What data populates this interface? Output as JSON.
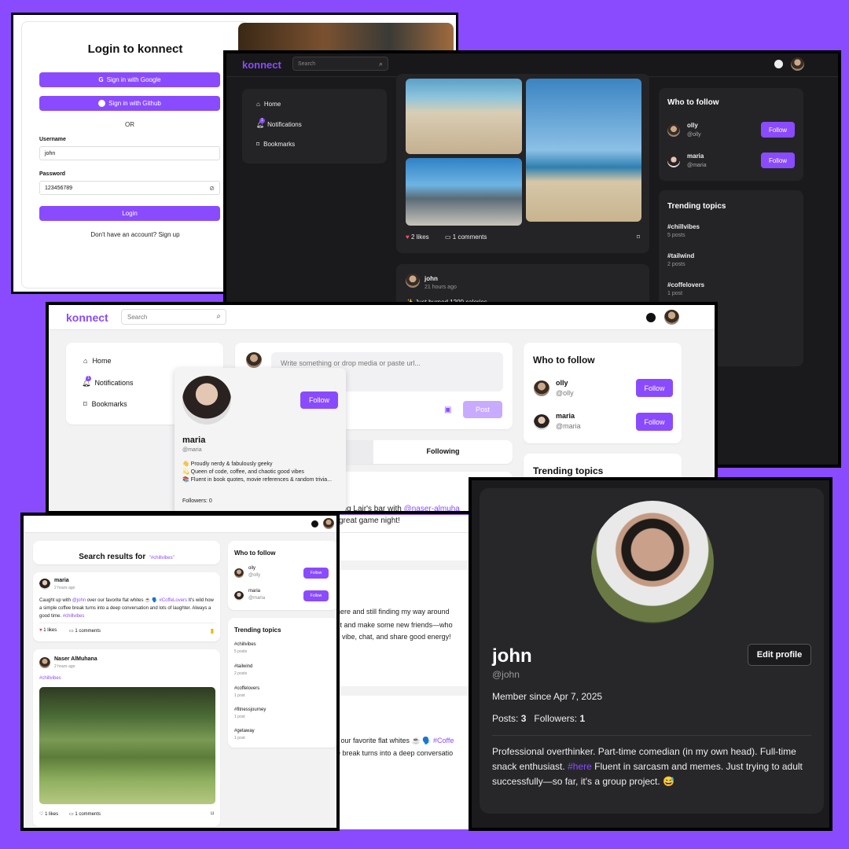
{
  "brand": "konnect",
  "colors": {
    "accent": "#8a4bff",
    "dark_bg": "#1a1a1c",
    "light_bg": "#f2f2f3"
  },
  "login": {
    "title": "Login to konnect",
    "google_btn": "Sign in with Google",
    "github_btn": "Sign in with Github",
    "or": "OR",
    "username_label": "Username",
    "username_value": "john",
    "password_label": "Password",
    "password_value": "123456789",
    "login_btn": "Login",
    "signup_text": "Don't have an account? Sign up"
  },
  "dark": {
    "search_placeholder": "Search",
    "nav": [
      {
        "label": "Home",
        "icon": "home-icon"
      },
      {
        "label": "Notifications",
        "icon": "bell-icon",
        "badge": "1"
      },
      {
        "label": "Bookmarks",
        "icon": "bookmark-icon"
      }
    ],
    "post": {
      "likes": "2 likes",
      "comments": "1 comments"
    },
    "post2": {
      "author": "john",
      "time": "21 hours ago",
      "text": "✨ Just burned 1200 calories"
    },
    "who_to_follow": {
      "title": "Who to follow",
      "users": [
        {
          "name": "olly",
          "handle": "@olly",
          "btn": "Follow"
        },
        {
          "name": "maria",
          "handle": "@maria",
          "btn": "Follow"
        }
      ]
    },
    "trending": {
      "title": "Trending topics",
      "items": [
        {
          "tag": "#chillvibes",
          "count": "5 posts"
        },
        {
          "tag": "#tailwind",
          "count": "2 posts"
        },
        {
          "tag": "#coffelovers",
          "count": "1 post"
        }
      ]
    }
  },
  "light": {
    "search_placeholder": "Search",
    "nav": [
      {
        "label": "Home"
      },
      {
        "label": "Notifications",
        "badge": "1"
      },
      {
        "label": "Bookmarks"
      }
    ],
    "composer_placeholder": "Write something or drop media or paste url...",
    "post_btn": "Post",
    "tab_following": "Following",
    "hover_card": {
      "name": "maria",
      "handle": "@maria",
      "follow": "Follow",
      "bio": [
        "👋 Proudly nerdy & fabulously geeky",
        "💫 Queen of code, coffee, and chaotic good vibes",
        "📚 Fluent in book quotes, movie references & random trivia..."
      ],
      "followers": "Followers: 0"
    },
    "feed_line1": "...had an amazing time playing Lair's bar with",
    "feed_mention": "@naser-almuha",
    "feed_line2": "great game night!",
    "who_to_follow": {
      "title": "Who to follow",
      "users": [
        {
          "name": "olly",
          "handle": "@olly",
          "btn": "Follow"
        },
        {
          "name": "maria",
          "handle": "@maria",
          "btn": "Follow"
        }
      ]
    },
    "trending_title": "Trending topics"
  },
  "search": {
    "title_prefix": "Search results for",
    "query": "\"#chillvibes\"",
    "post1": {
      "author": "maria",
      "time": "2 hours ago",
      "text1": "Caught up with",
      "mention": "@john",
      "text2": "over our favorite flat whites ☕ 🗣️",
      "tag1": "#CoffeLovers",
      "text3": "It's wild how a simple coffee break turns into a deep conversation and lots of laughter. Always a good time.",
      "tag2": "#chillvibes",
      "likes": "1 likes",
      "comments": "1 comments"
    },
    "post2": {
      "author": "Naser AlMuhana",
      "time": "2 hours ago",
      "tag": "#chillvibes",
      "likes": "1 likes",
      "comments": "1 comments"
    },
    "who_to_follow": {
      "title": "Who to follow",
      "users": [
        {
          "name": "olly",
          "handle": "@olly",
          "btn": "Follow"
        },
        {
          "name": "maria",
          "handle": "@maria",
          "btn": "Follow"
        }
      ]
    },
    "trending": {
      "title": "Trending topics",
      "items": [
        {
          "tag": "#chillvibes",
          "count": "5 posts"
        },
        {
          "tag": "#tailwind",
          "count": "2 posts"
        },
        {
          "tag": "#coffelovers",
          "count": "1 post"
        },
        {
          "tag": "#fitnessjourney",
          "count": "1 post"
        },
        {
          "tag": "#getaway",
          "count": "1 post"
        }
      ]
    },
    "bg_snippets": [
      "here and still finding my way around",
      "ct and make some new friends—who",
      "s vibe, chat, and share good energy!",
      "r our favorite flat whites ☕ 🗣️",
      "e break turns into a deep conversatio"
    ],
    "bg_tag": "#Coffe"
  },
  "profile": {
    "name": "john",
    "handle": "@john",
    "edit_btn": "Edit profile",
    "member_since": "Member since Apr 7, 2025",
    "posts_label": "Posts:",
    "posts": "3",
    "followers_label": "Followers:",
    "followers": "1",
    "bio1": "Professional overthinker. Part-time comedian (in my own head). Full-time snack enthusiast.",
    "bio_tag": "#here",
    "bio2": "Fluent in sarcasm and memes. Just trying to adult successfully—so far, it's a group project. 😅"
  }
}
